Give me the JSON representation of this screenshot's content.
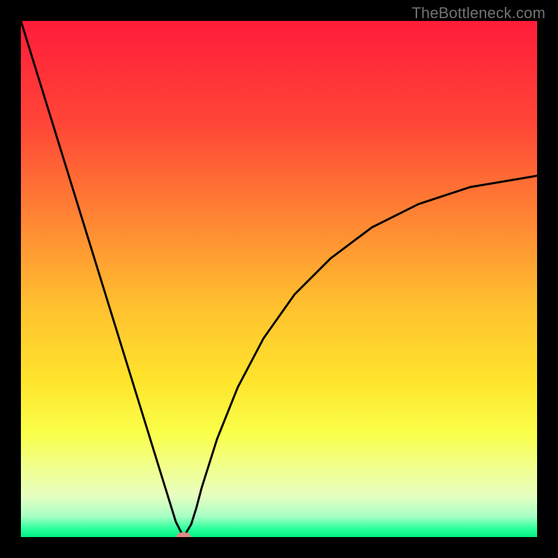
{
  "attribution": "TheBottleneck.com",
  "chart_data": {
    "type": "line",
    "title": "",
    "xlabel": "",
    "ylabel": "",
    "xlim": [
      0,
      100
    ],
    "ylim": [
      0,
      100
    ],
    "background_gradient_stops": [
      {
        "offset": 0.0,
        "color": "#ff1c3a"
      },
      {
        "offset": 0.2,
        "color": "#ff4637"
      },
      {
        "offset": 0.4,
        "color": "#ff8b33"
      },
      {
        "offset": 0.55,
        "color": "#ffc02f"
      },
      {
        "offset": 0.7,
        "color": "#ffe52c"
      },
      {
        "offset": 0.8,
        "color": "#f9ff4a"
      },
      {
        "offset": 0.86,
        "color": "#f2ff88"
      },
      {
        "offset": 0.92,
        "color": "#e7ffc0"
      },
      {
        "offset": 0.96,
        "color": "#a6ffc4"
      },
      {
        "offset": 0.984,
        "color": "#2aff9b"
      },
      {
        "offset": 1.0,
        "color": "#00ef82"
      }
    ],
    "series": [
      {
        "name": "bottleneck-curve",
        "x": [
          0,
          3,
          6,
          9,
          12,
          15,
          18,
          21,
          24,
          27,
          30,
          31.5,
          33,
          34,
          35,
          38,
          42,
          47,
          53,
          60,
          68,
          77,
          87,
          100
        ],
        "y": [
          100,
          90.3,
          80.6,
          70.9,
          61.2,
          51.5,
          41.8,
          32.1,
          22.4,
          12.7,
          3.0,
          0.0,
          2.5,
          5.7,
          9.5,
          19.0,
          29.0,
          38.5,
          47.0,
          54.0,
          60.0,
          64.5,
          67.8,
          70.0
        ]
      }
    ],
    "trough_marker": {
      "x": 31.5,
      "y": 0.05,
      "rx": 1.4,
      "ry": 0.9,
      "color": "#e18a87"
    }
  }
}
